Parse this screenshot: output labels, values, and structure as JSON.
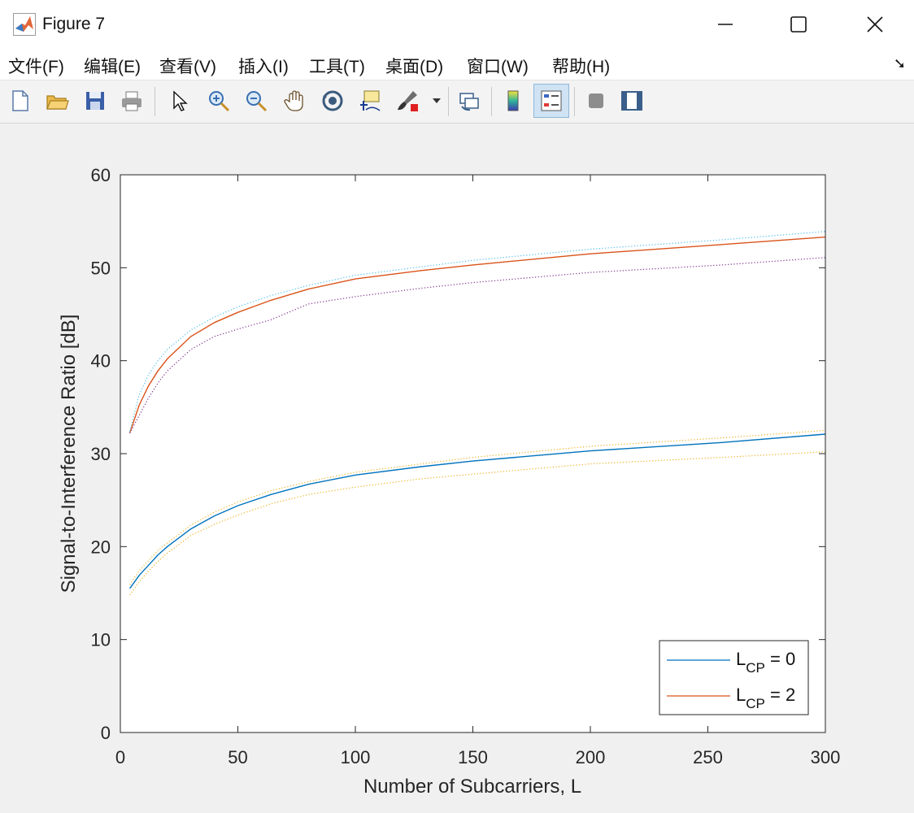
{
  "window": {
    "title": "Figure 7"
  },
  "menu": [
    {
      "label": "文件(F)"
    },
    {
      "label": "编辑(E)"
    },
    {
      "label": "查看(V)"
    },
    {
      "label": "插入(I)"
    },
    {
      "label": "工具(T)"
    },
    {
      "label": "桌面(D)"
    },
    {
      "label": "窗口(W)"
    },
    {
      "label": "帮助(H)"
    }
  ],
  "toolbar": [
    {
      "icon": "new-figure-icon"
    },
    {
      "icon": "open-folder-icon"
    },
    {
      "icon": "save-icon"
    },
    {
      "icon": "print-icon"
    },
    {
      "icon": "pointer-icon"
    },
    {
      "icon": "zoom-in-icon"
    },
    {
      "icon": "zoom-out-icon"
    },
    {
      "icon": "pan-hand-icon"
    },
    {
      "icon": "rotate-3d-icon"
    },
    {
      "icon": "data-cursor-icon"
    },
    {
      "icon": "brush-icon"
    },
    {
      "icon": "link-plot-icon"
    },
    {
      "icon": "colorbar-icon"
    },
    {
      "icon": "legend-icon"
    },
    {
      "icon": "hide-plot-tools-icon"
    },
    {
      "icon": "show-plot-tools-icon"
    }
  ],
  "chart_data": {
    "type": "line",
    "title": "",
    "xlabel": "Number of Subcarriers, L",
    "ylabel": "Signal-to-Interference Ratio [dB]",
    "xlim": [
      0,
      300
    ],
    "ylim": [
      0,
      60
    ],
    "xticks": [
      "0",
      "50",
      "100",
      "150",
      "200",
      "250",
      "300"
    ],
    "yticks": [
      "0",
      "10",
      "20",
      "30",
      "40",
      "50",
      "60"
    ],
    "grid": false,
    "legend_position": "bottom-right",
    "series": [
      {
        "name": "L_CP = 0",
        "legend_main": "L",
        "legend_sub": "CP",
        "legend_tail": " = 0",
        "color": "#0072BD",
        "style": "solid",
        "x": [
          4,
          8,
          12,
          16,
          20,
          30,
          40,
          50,
          64,
          80,
          100,
          128,
          150,
          200,
          256,
          300
        ],
        "y": [
          15.5,
          16.9,
          18.0,
          19.1,
          20.0,
          21.9,
          23.3,
          24.4,
          25.6,
          26.7,
          27.7,
          28.6,
          29.2,
          30.3,
          31.2,
          32.1
        ]
      },
      {
        "name": "L_CP = 2",
        "legend_main": "L",
        "legend_sub": "CP",
        "legend_tail": " = 2",
        "color": "#D95319",
        "style": "solid",
        "x": [
          4,
          8,
          12,
          16,
          20,
          30,
          40,
          50,
          64,
          80,
          100,
          128,
          150,
          200,
          256,
          300
        ],
        "y": [
          32.2,
          35.2,
          37.3,
          38.9,
          40.2,
          42.6,
          44.1,
          45.2,
          46.5,
          47.7,
          48.8,
          49.7,
          50.3,
          51.5,
          52.5,
          53.3
        ]
      },
      {
        "color": "#4DBEEE",
        "style": "dotted",
        "x": [
          4,
          8,
          12,
          16,
          20,
          30,
          40,
          50,
          64,
          80,
          100,
          128,
          150,
          200,
          256,
          300
        ],
        "y": [
          32.4,
          36.3,
          38.5,
          40.0,
          41.2,
          43.3,
          44.7,
          45.8,
          47.0,
          48.1,
          49.2,
          50.1,
          50.8,
          52.0,
          53.0,
          53.9
        ]
      },
      {
        "color": "#7E2F8E",
        "style": "dotted",
        "x": [
          4,
          8,
          12,
          16,
          20,
          30,
          40,
          50,
          64,
          80,
          100,
          128,
          150,
          200,
          256,
          300
        ],
        "y": [
          32.2,
          34.1,
          36.0,
          37.6,
          38.9,
          41.2,
          42.6,
          43.4,
          44.4,
          46.1,
          46.9,
          47.8,
          48.4,
          49.5,
          50.3,
          51.1
        ]
      },
      {
        "color": "#EDB120",
        "style": "dotted",
        "x": [
          4,
          8,
          12,
          16,
          20,
          30,
          40,
          50,
          64,
          80,
          100,
          128,
          150,
          200,
          256,
          300
        ],
        "y": [
          15.9,
          17.4,
          18.5,
          19.6,
          20.4,
          22.3,
          23.7,
          24.8,
          26.0,
          27.0,
          28.0,
          28.9,
          29.6,
          30.8,
          31.7,
          32.5
        ]
      },
      {
        "color": "#EDB120",
        "style": "dotted",
        "x": [
          4,
          8,
          12,
          16,
          20,
          30,
          40,
          50,
          64,
          80,
          100,
          128,
          150,
          200,
          256,
          300
        ],
        "y": [
          14.8,
          16.2,
          17.4,
          18.4,
          19.3,
          21.2,
          22.4,
          23.4,
          24.6,
          25.6,
          26.4,
          27.3,
          27.8,
          28.9,
          29.6,
          30.2
        ]
      }
    ]
  }
}
